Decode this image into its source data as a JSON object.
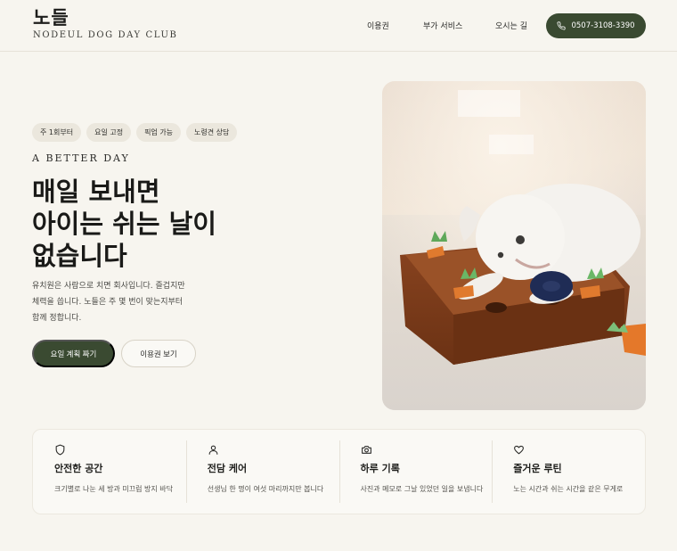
{
  "header": {
    "logo_ko": "노들",
    "logo_en": "NODEUL DOG DAY CLUB",
    "nav": [
      "이용권",
      "부가 서비스",
      "오시는 길"
    ],
    "phone": "0507-3108-3390",
    "phone_icon": "phone-icon"
  },
  "hero": {
    "chips": [
      "주 1회부터",
      "요일 고정",
      "픽업 가능",
      "노령견 상담"
    ],
    "eyebrow": "A BETTER DAY",
    "headline": [
      "매일 보내면",
      "아이는 쉬는 날이",
      "없습니다"
    ],
    "body": [
      "유치원은 사람으로 치면 회사입니다. 즐겁지만",
      "체력을 씁니다. 노들은 주 몇 번이 맞는지부터",
      "함께 정합니다."
    ],
    "primary_button": "요일 계획 짜기",
    "secondary_button": "이용권 보기",
    "image_alt": "white puppy lying on a carrot snuffle toy"
  },
  "features": [
    {
      "icon": "shield-icon",
      "title": "안전한 공간",
      "desc": "크기별로 나눈 세 방과 미끄럼 방지 바닥"
    },
    {
      "icon": "person-icon",
      "title": "전담 케어",
      "desc": "선생님 한 명이 여섯 마리까지만 봅니다"
    },
    {
      "icon": "camera-icon",
      "title": "하루 기록",
      "desc": "사진과 메모로 그날 있었던 일을 보냅니다"
    },
    {
      "icon": "heart-icon",
      "title": "즐거운 루틴",
      "desc": "노는 시간과 쉬는 시간을 같은 무게로"
    }
  ],
  "colors": {
    "background": "#f7f5ef",
    "accent": "#3a4a31",
    "chip": "#ebe7dd"
  }
}
